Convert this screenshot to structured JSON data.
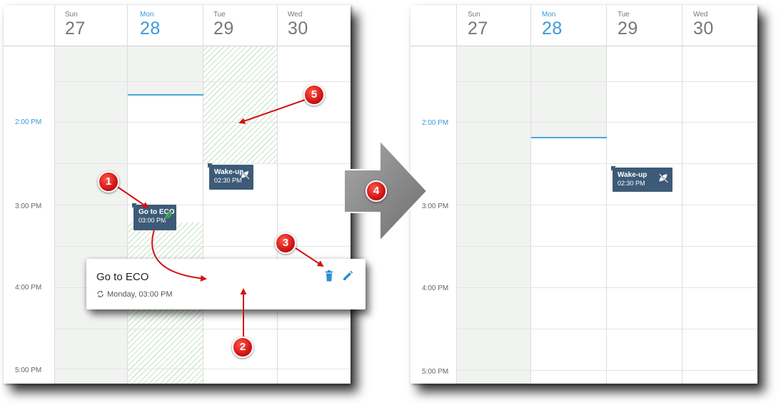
{
  "left_calendar": {
    "days": [
      {
        "name": "Sun",
        "date": "27"
      },
      {
        "name": "Mon",
        "date": "28"
      },
      {
        "name": "Tue",
        "date": "29"
      },
      {
        "name": "Wed",
        "date": "30"
      }
    ],
    "times": [
      "2:00 PM",
      "3:00 PM",
      "4:00 PM",
      "5:00 PM"
    ],
    "events": [
      {
        "title": "Go to ECO",
        "time": "03:00 PM",
        "icon": "leaf-icon"
      },
      {
        "title": "Wake-up",
        "time": "02:30 PM",
        "icon": "eco-off-icon"
      }
    ],
    "popup": {
      "title": "Go to ECO",
      "subtitle": "Monday, 03:00 PM",
      "delete_icon": "trash-icon",
      "edit_icon": "pencil-icon"
    }
  },
  "right_calendar": {
    "days": [
      {
        "name": "Sun",
        "date": "27"
      },
      {
        "name": "Mon",
        "date": "28"
      },
      {
        "name": "Tue",
        "date": "29"
      },
      {
        "name": "Wed",
        "date": "30"
      }
    ],
    "times": [
      "2:00 PM",
      "3:00 PM",
      "4:00 PM",
      "5:00 PM"
    ],
    "events": [
      {
        "title": "Wake-up",
        "time": "02:30 PM",
        "icon": "eco-off-icon"
      }
    ]
  },
  "callouts": [
    "1",
    "2",
    "3",
    "4",
    "5"
  ],
  "colors": {
    "accent": "#3a9ad9",
    "event_bg": "#3d5b78",
    "callout_red": "#d11414",
    "arrow_grey": "#8a8a8a"
  }
}
